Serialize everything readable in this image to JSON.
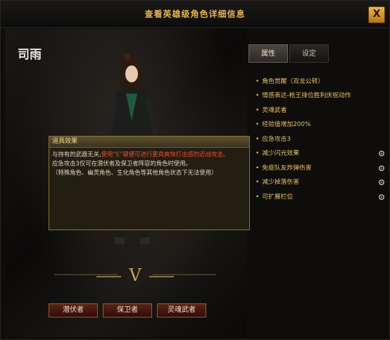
{
  "window": {
    "title": "查看英雄级角色详细信息",
    "close_label": "X"
  },
  "hero": {
    "name": "司雨"
  },
  "tabs": [
    {
      "label": "属性",
      "active": true
    },
    {
      "label": "设定",
      "active": false
    }
  ],
  "attributes": [
    {
      "label": "角色觉醒（双龙公转）",
      "has_icon": false
    },
    {
      "label": "情感表达-枪王排位胜利庆祝动作",
      "has_icon": false
    },
    {
      "label": "灵魂武者",
      "has_icon": false
    },
    {
      "label": "经验值增加200%",
      "has_icon": false
    },
    {
      "label": "应急攻击3",
      "has_icon": false
    },
    {
      "label": "减少闪光效果",
      "has_icon": true,
      "icon": "gear-icon"
    },
    {
      "label": "免疫队友炸弹伤害",
      "has_icon": true,
      "icon": "gear-icon"
    },
    {
      "label": "减少掉落伤害",
      "has_icon": true,
      "icon": "gear-icon"
    },
    {
      "label": "可扩展栏位",
      "has_icon": true,
      "icon": "gear-icon"
    }
  ],
  "tooltip": {
    "title": "道具效果",
    "line1_a": "与持有的武器无关,",
    "line1_b": "使用“E”键便可进行更具爽快打击感的近战攻击。",
    "line2": "应急攻击3仅可在潜伏者及保卫者阵容的角色时使用。",
    "line3": "（特殊角色、幽灵角色、生化角色等其他角色状态下无法使用）"
  },
  "class_buttons": [
    {
      "label": "潜伏者"
    },
    {
      "label": "保卫者"
    },
    {
      "label": "灵魂武者"
    }
  ],
  "emblem": {
    "label": "V"
  },
  "colors": {
    "accent": "#e8c060",
    "title": "#e6b54a",
    "highlight": "#e84c34"
  }
}
